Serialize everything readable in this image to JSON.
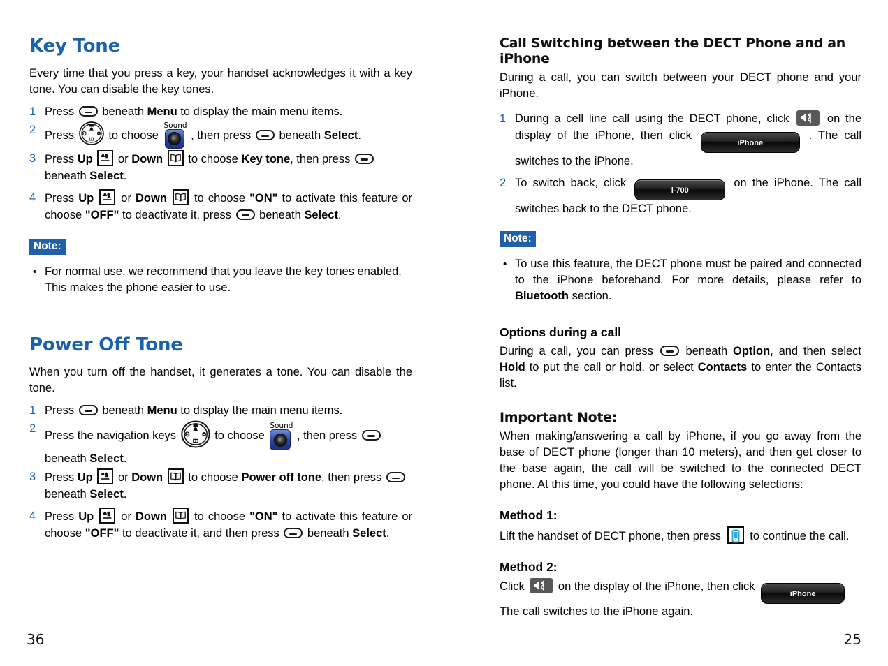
{
  "meta": {
    "accent_blue": "#1a63ac",
    "note_badge_bg": "#1f60a8",
    "step_number_color": "#1a63ac"
  },
  "left_page": {
    "folio": "36",
    "sections": [
      {
        "heading": "Key Tone",
        "intro": "Every time that you press a key, your handset acknowledges it with a key tone. You can disable the key tones.",
        "steps": [
          {
            "number": "1",
            "parts": [
              "Press ",
              "[softkey]",
              " beneath ",
              "Menu",
              " to display the main menu items."
            ]
          },
          {
            "number": "2",
            "parts": [
              "Press ",
              "[navwheel]",
              " to choose ",
              "[sound]",
              ", then press ",
              "[softkey]",
              " beneath ",
              "Select",
              "."
            ]
          },
          {
            "number": "3",
            "parts": [
              "Press ",
              "Up",
              " [upkey] ",
              "or ",
              "Down",
              " [downkey] ",
              "to choose ",
              "Key tone",
              ", then press ",
              "[softkey]",
              " beneath ",
              "Select",
              "."
            ]
          },
          {
            "number": "4",
            "parts": [
              "Press ",
              "Up",
              " [upkey] ",
              "or ",
              "Down",
              " [downkey] ",
              "to choose ",
              "\"ON\"",
              " to activate this feature or choose ",
              "\"OFF\"",
              " to deactivate it, press ",
              "[softkey]",
              " beneath ",
              "Select",
              "."
            ]
          }
        ],
        "note": {
          "label": "Note:",
          "bullet": "•",
          "text": "For normal use, we recommend that you leave the key tones enabled. This makes the phone easier to use."
        }
      },
      {
        "heading": "Power Off Tone",
        "intro": "When you turn off the handset, it generates a tone. You can disable the tone.",
        "steps": [
          {
            "number": "1",
            "parts": [
              "Press ",
              "[softkey]",
              " beneath ",
              "Menu",
              " to display the main menu items."
            ]
          },
          {
            "number": "2",
            "parts": [
              "Press the navigation keys ",
              "[navwheel]",
              " to choose ",
              "[sound]",
              ", then press ",
              "[softkey]",
              " beneath ",
              "Select",
              "."
            ]
          },
          {
            "number": "3",
            "parts": [
              "Press ",
              "Up",
              " [upkey] ",
              "or ",
              "Down",
              " [downkey] ",
              "to choose ",
              "Power off tone",
              ", then press ",
              "[softkey]",
              " beneath ",
              "Select",
              "."
            ]
          },
          {
            "number": "4",
            "parts": [
              "Press ",
              "Up",
              " [upkey] ",
              "or ",
              "Down",
              " [downkey] ",
              "to choose ",
              "\"ON\"",
              " to activate this feature or choose ",
              "\"OFF\"",
              " to deactivate it, and then press ",
              "[softkey]",
              " beneath ",
              "Select",
              "."
            ]
          }
        ]
      }
    ]
  },
  "right_page": {
    "folio": "25",
    "heading": "Call Switching between the DECT Phone and an iPhone",
    "intro": "During a call, you can switch between your DECT phone and your iPhone.",
    "steps": [
      {
        "number": "1",
        "text_a": "During a cell line call using the DECT phone, click ",
        "text_b": " on the display of the iPhone, then click ",
        "button_label": "iPhone",
        "text_c": ". The call switches to the iPhone."
      },
      {
        "number": "2",
        "text_a": "To switch back, click ",
        "button_label": "i-700",
        "text_b": " on the iPhone. The call switches back to the DECT phone."
      }
    ],
    "note": {
      "label": "Note:",
      "bullet": "•",
      "text_a": "To use this feature, the DECT phone must be paired and connected to the iPhone beforehand. For more details, please refer to ",
      "bold": "Bluetooth",
      "text_b": " section."
    },
    "options": {
      "heading": "Options during a call",
      "text_a": "During a call, you can press ",
      "text_b": " beneath ",
      "bold_option": "Option",
      "text_c": ", and then select ",
      "bold_hold": "Hold",
      "text_d": " to put the call or hold, or select ",
      "bold_contacts": "Contacts",
      "text_e": " to enter the Contacts list."
    },
    "important": {
      "heading": "Important Note:",
      "text": "When making/answering a call by iPhone, if you go away from the base of DECT phone (longer than 10 meters), and then get closer to the base again, the call will be switched to the connected DECT phone. At this time, you could have the following selections:"
    },
    "method1": {
      "heading": "Method 1:",
      "text_a": "Lift the handset of DECT phone, then press ",
      "text_b": " to continue the call."
    },
    "method2": {
      "heading": "Method 2:",
      "text_a": "Click ",
      "text_b": " on the display of the iPhone, then click ",
      "button_label": "iPhone",
      "text_c": "The call switches to the iPhone again."
    }
  }
}
